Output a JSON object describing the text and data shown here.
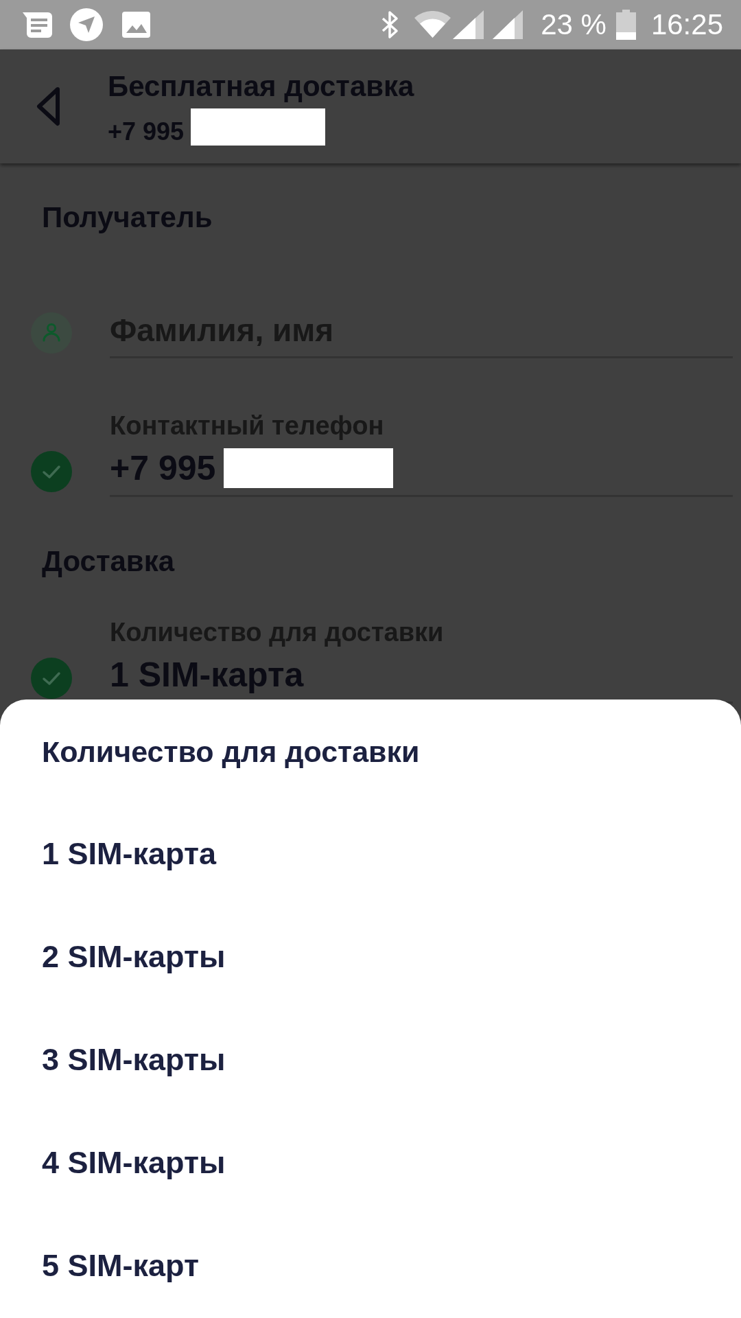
{
  "status_bar": {
    "battery": "23 %",
    "time": "16:25"
  },
  "app_bar": {
    "title": "Бесплатная доставка",
    "subtitle": "+7 995",
    "redacted": true
  },
  "sections": [
    {
      "title": "Получатель",
      "fields": [
        {
          "kind": "name",
          "placeholder": "Фамилия, имя",
          "completed": false,
          "redacted": false
        },
        {
          "kind": "phone",
          "label": "Контактный телефон",
          "value": "+7 995",
          "completed": true,
          "redacted": true
        }
      ]
    },
    {
      "title": "Доставка",
      "fields": [
        {
          "kind": "quantity",
          "label": "Количество для доставки",
          "value": "1 SIM-карта",
          "completed": true,
          "redacted": false
        }
      ]
    }
  ],
  "sheet": {
    "title": "Количество для доставки",
    "options": [
      {
        "label": "1 SIM-карта",
        "selected": false
      },
      {
        "label": "2 SIM-карты",
        "selected": false
      },
      {
        "label": "3 SIM-карты",
        "selected": false
      },
      {
        "label": "4 SIM-карты",
        "selected": false
      },
      {
        "label": "5 SIM-карт",
        "selected": false
      }
    ]
  }
}
